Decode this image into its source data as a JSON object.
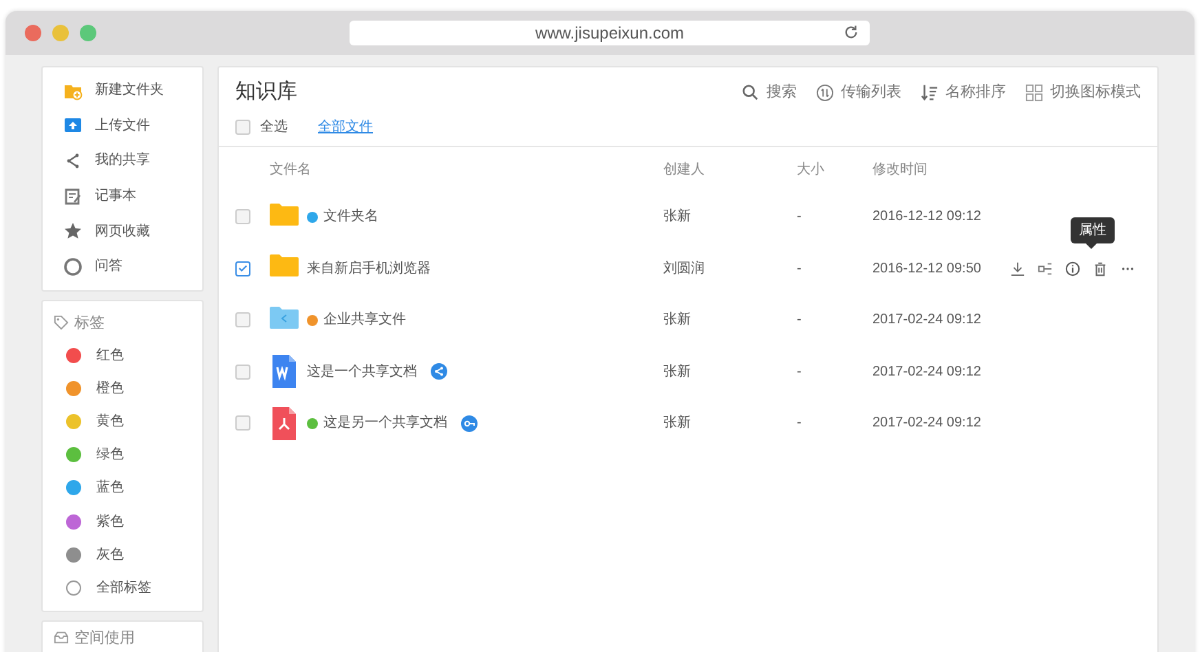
{
  "browser": {
    "url": "www.jisupeixun.com"
  },
  "sidebar": {
    "actions": [
      {
        "label": "新建文件夹",
        "kind": "new-folder"
      },
      {
        "label": "上传文件",
        "kind": "upload"
      },
      {
        "label": "我的共享",
        "kind": "share"
      },
      {
        "label": "记事本",
        "kind": "note"
      },
      {
        "label": "网页收藏",
        "kind": "star"
      },
      {
        "label": "问答",
        "kind": "qa"
      }
    ],
    "tags_title": "标签",
    "tags": [
      {
        "label": "红色",
        "color": "#f24d4d"
      },
      {
        "label": "橙色",
        "color": "#f0932b"
      },
      {
        "label": "黄色",
        "color": "#ecc22a"
      },
      {
        "label": "绿色",
        "color": "#5cbf3f"
      },
      {
        "label": "蓝色",
        "color": "#2ea7ea"
      },
      {
        "label": "紫色",
        "color": "#bd66d6"
      },
      {
        "label": "灰色",
        "color": "#8e8e8e"
      },
      {
        "label": "全部标签"
      }
    ],
    "usage_title": "空间使用"
  },
  "main": {
    "title": "知识库",
    "toolbar": [
      {
        "label": "搜索",
        "kind": "search"
      },
      {
        "label": "传输列表",
        "kind": "transfer"
      },
      {
        "label": "名称排序",
        "kind": "sort"
      },
      {
        "label": "切换图标模式",
        "kind": "grid"
      }
    ],
    "select_all": {
      "label": "全选",
      "checked": false
    },
    "breadcrumb": "全部文件",
    "columns": [
      "文件名",
      "创建人",
      "大小",
      "修改时间"
    ],
    "rows": [
      {
        "kind": "folder",
        "color": "#2ea7ea",
        "name": "文件夹名",
        "creator": "张新",
        "size": "-",
        "modified": "2016-12-12 09:12",
        "checked": false
      },
      {
        "kind": "folder",
        "name": "来自新启手机浏览器",
        "creator": "刘圆润",
        "size": "-",
        "modified": "2016-12-12 09:50",
        "checked": true,
        "hovered": true,
        "tooltip": "属性"
      },
      {
        "kind": "shared-folder",
        "color": "#f0932b",
        "name": "企业共享文件",
        "creator": "张新",
        "size": "-",
        "modified": "2017-02-24 09:12",
        "checked": false
      },
      {
        "kind": "word",
        "name": "这是一个共享文档",
        "badge": {
          "kind": "share"
        },
        "creator": "张新",
        "size": "-",
        "modified": "2017-02-24 09:12",
        "checked": false
      },
      {
        "kind": "pdf",
        "color": "#5cbf3f",
        "name": "这是另一个共享文档",
        "badge": {
          "kind": "link"
        },
        "creator": "张新",
        "size": "-",
        "modified": "2017-02-24 09:12",
        "checked": false
      }
    ]
  }
}
